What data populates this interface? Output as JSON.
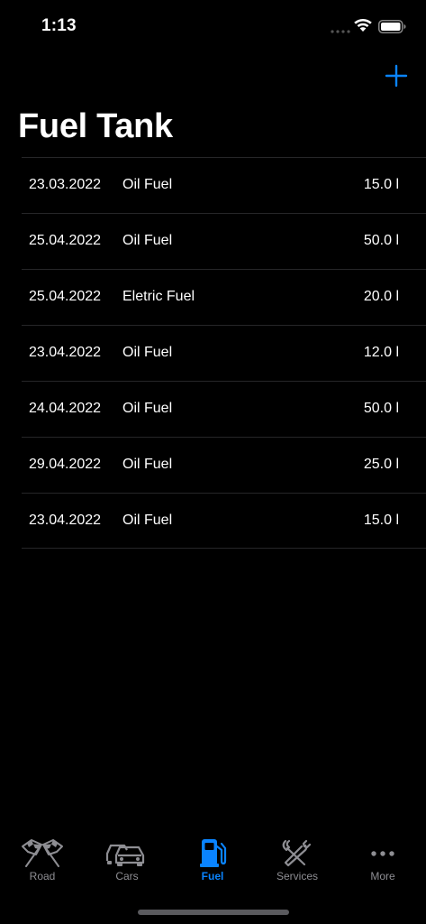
{
  "status_bar": {
    "time": "1:13"
  },
  "header": {
    "title": "Fuel Tank",
    "add_icon": "plus-icon"
  },
  "entries": [
    {
      "date": "23.03.2022",
      "type": "Oil Fuel",
      "amount": "15.0 l"
    },
    {
      "date": "25.04.2022",
      "type": "Oil Fuel",
      "amount": "50.0 l"
    },
    {
      "date": "25.04.2022",
      "type": "Eletric Fuel",
      "amount": "20.0 l"
    },
    {
      "date": "23.04.2022",
      "type": "Oil Fuel",
      "amount": "12.0 l"
    },
    {
      "date": "24.04.2022",
      "type": "Oil Fuel",
      "amount": "50.0 l"
    },
    {
      "date": "29.04.2022",
      "type": "Oil Fuel",
      "amount": "25.0 l"
    },
    {
      "date": "23.04.2022",
      "type": "Oil Fuel",
      "amount": "15.0 l"
    }
  ],
  "tab_bar": {
    "tabs": [
      {
        "label": "Road",
        "icon": "checkered-flags-icon",
        "active": false
      },
      {
        "label": "Cars",
        "icon": "cars-icon",
        "active": false
      },
      {
        "label": "Fuel",
        "icon": "fuel-pump-icon",
        "active": true
      },
      {
        "label": "Services",
        "icon": "tools-icon",
        "active": false
      },
      {
        "label": "More",
        "icon": "more-dots-icon",
        "active": false
      }
    ]
  },
  "colors": {
    "accent": "#0a84ff",
    "background": "#000000",
    "separator": "#262628",
    "inactive_tab": "#8e8e93"
  }
}
